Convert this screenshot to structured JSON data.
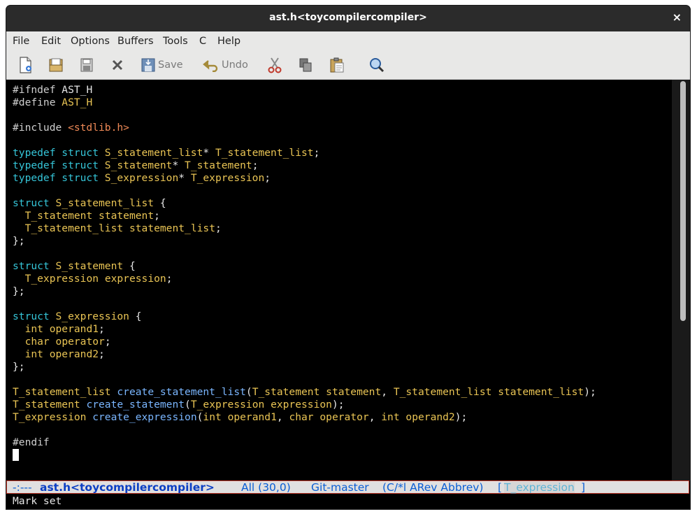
{
  "window": {
    "title": "ast.h<toycompilercompiler>",
    "close_glyph": "×"
  },
  "menu": [
    "File",
    "Edit",
    "Options",
    "Buffers",
    "Tools",
    "C",
    "Help"
  ],
  "toolbar": {
    "items": [
      {
        "icon": "new-file-icon"
      },
      {
        "icon": "open-folder-icon"
      },
      {
        "icon": "save-disk-icon"
      },
      {
        "icon": "close-x-icon"
      },
      {
        "icon": "save-icon",
        "label": "Save"
      },
      {
        "icon": "undo-icon",
        "label": "Undo"
      },
      {
        "icon": "cut-icon"
      },
      {
        "icon": "copy-icon"
      },
      {
        "icon": "paste-icon"
      },
      {
        "icon": "search-icon"
      }
    ]
  },
  "editor": {
    "lines": [
      [
        {
          "t": "#ifndef ",
          "c": "pp"
        },
        {
          "t": "AST_H",
          "c": ""
        }
      ],
      [
        {
          "t": "#define ",
          "c": "pp"
        },
        {
          "t": "AST_H",
          "c": "ty"
        }
      ],
      [],
      [
        {
          "t": "#include ",
          "c": "pp"
        },
        {
          "t": "<stdlib.h>",
          "c": "st"
        }
      ],
      [],
      [
        {
          "t": "typedef struct ",
          "c": "kw"
        },
        {
          "t": "S_statement_list",
          "c": "ty"
        },
        {
          "t": "* ",
          "c": ""
        },
        {
          "t": "T_statement_list",
          "c": "ty"
        },
        {
          "t": ";",
          "c": ""
        }
      ],
      [
        {
          "t": "typedef struct ",
          "c": "kw"
        },
        {
          "t": "S_statement",
          "c": "ty"
        },
        {
          "t": "* ",
          "c": ""
        },
        {
          "t": "T_statement",
          "c": "ty"
        },
        {
          "t": ";",
          "c": ""
        }
      ],
      [
        {
          "t": "typedef struct ",
          "c": "kw"
        },
        {
          "t": "S_expression",
          "c": "ty"
        },
        {
          "t": "* ",
          "c": ""
        },
        {
          "t": "T_expression",
          "c": "ty"
        },
        {
          "t": ";",
          "c": ""
        }
      ],
      [],
      [
        {
          "t": "struct ",
          "c": "kw"
        },
        {
          "t": "S_statement_list",
          "c": "ty"
        },
        {
          "t": " {",
          "c": ""
        }
      ],
      [
        {
          "t": "  ",
          "c": ""
        },
        {
          "t": "T_statement",
          "c": "ty"
        },
        {
          "t": " ",
          "c": ""
        },
        {
          "t": "statement",
          "c": "ty"
        },
        {
          "t": ";",
          "c": ""
        }
      ],
      [
        {
          "t": "  ",
          "c": ""
        },
        {
          "t": "T_statement_list",
          "c": "ty"
        },
        {
          "t": " ",
          "c": ""
        },
        {
          "t": "statement_list",
          "c": "ty"
        },
        {
          "t": ";",
          "c": ""
        }
      ],
      [
        {
          "t": "};",
          "c": ""
        }
      ],
      [],
      [
        {
          "t": "struct ",
          "c": "kw"
        },
        {
          "t": "S_statement",
          "c": "ty"
        },
        {
          "t": " {",
          "c": ""
        }
      ],
      [
        {
          "t": "  ",
          "c": ""
        },
        {
          "t": "T_expression",
          "c": "ty"
        },
        {
          "t": " ",
          "c": ""
        },
        {
          "t": "expression",
          "c": "ty"
        },
        {
          "t": ";",
          "c": ""
        }
      ],
      [
        {
          "t": "};",
          "c": ""
        }
      ],
      [],
      [
        {
          "t": "struct ",
          "c": "kw"
        },
        {
          "t": "S_expression",
          "c": "ty"
        },
        {
          "t": " {",
          "c": ""
        }
      ],
      [
        {
          "t": "  ",
          "c": ""
        },
        {
          "t": "int",
          "c": "ty"
        },
        {
          "t": " ",
          "c": ""
        },
        {
          "t": "operand1",
          "c": "ty"
        },
        {
          "t": ";",
          "c": ""
        }
      ],
      [
        {
          "t": "  ",
          "c": ""
        },
        {
          "t": "char",
          "c": "ty"
        },
        {
          "t": " ",
          "c": ""
        },
        {
          "t": "operator",
          "c": "ty"
        },
        {
          "t": ";",
          "c": ""
        }
      ],
      [
        {
          "t": "  ",
          "c": ""
        },
        {
          "t": "int",
          "c": "ty"
        },
        {
          "t": " ",
          "c": ""
        },
        {
          "t": "operand2",
          "c": "ty"
        },
        {
          "t": ";",
          "c": ""
        }
      ],
      [
        {
          "t": "};",
          "c": ""
        }
      ],
      [],
      [
        {
          "t": "T_statement_list",
          "c": "ty"
        },
        {
          "t": " ",
          "c": ""
        },
        {
          "t": "create_statement_list",
          "c": "fn"
        },
        {
          "t": "(",
          "c": ""
        },
        {
          "t": "T_statement",
          "c": "ty"
        },
        {
          "t": " ",
          "c": ""
        },
        {
          "t": "statement",
          "c": "ty"
        },
        {
          "t": ", ",
          "c": ""
        },
        {
          "t": "T_statement_list",
          "c": "ty"
        },
        {
          "t": " ",
          "c": ""
        },
        {
          "t": "statement_list",
          "c": "ty"
        },
        {
          "t": ");",
          "c": ""
        }
      ],
      [
        {
          "t": "T_statement",
          "c": "ty"
        },
        {
          "t": " ",
          "c": ""
        },
        {
          "t": "create_statement",
          "c": "fn"
        },
        {
          "t": "(",
          "c": ""
        },
        {
          "t": "T_expression",
          "c": "ty"
        },
        {
          "t": " ",
          "c": ""
        },
        {
          "t": "expression",
          "c": "ty"
        },
        {
          "t": ");",
          "c": ""
        }
      ],
      [
        {
          "t": "T_expression",
          "c": "ty"
        },
        {
          "t": " ",
          "c": ""
        },
        {
          "t": "create_expression",
          "c": "fn"
        },
        {
          "t": "(",
          "c": ""
        },
        {
          "t": "int",
          "c": "ty"
        },
        {
          "t": " ",
          "c": ""
        },
        {
          "t": "operand1",
          "c": "ty"
        },
        {
          "t": ", ",
          "c": ""
        },
        {
          "t": "char",
          "c": "ty"
        },
        {
          "t": " ",
          "c": ""
        },
        {
          "t": "operator",
          "c": "ty"
        },
        {
          "t": ", ",
          "c": ""
        },
        {
          "t": "int",
          "c": "ty"
        },
        {
          "t": " ",
          "c": ""
        },
        {
          "t": "operand2",
          "c": "ty"
        },
        {
          "t": ");",
          "c": ""
        }
      ],
      [],
      [
        {
          "t": "#endif",
          "c": "pp"
        }
      ],
      [
        {
          "cursor": true
        }
      ]
    ]
  },
  "modeline": {
    "status": "-:---",
    "buffer": "ast.h<toycompilercompiler>",
    "position": "All (30,0)",
    "vc": "Git-master",
    "modes": "(C/*l ARev Abbrev)",
    "open_bracket": "[",
    "function": "T_expression",
    "close_bracket": "]"
  },
  "minibuffer": {
    "message": "Mark set"
  }
}
